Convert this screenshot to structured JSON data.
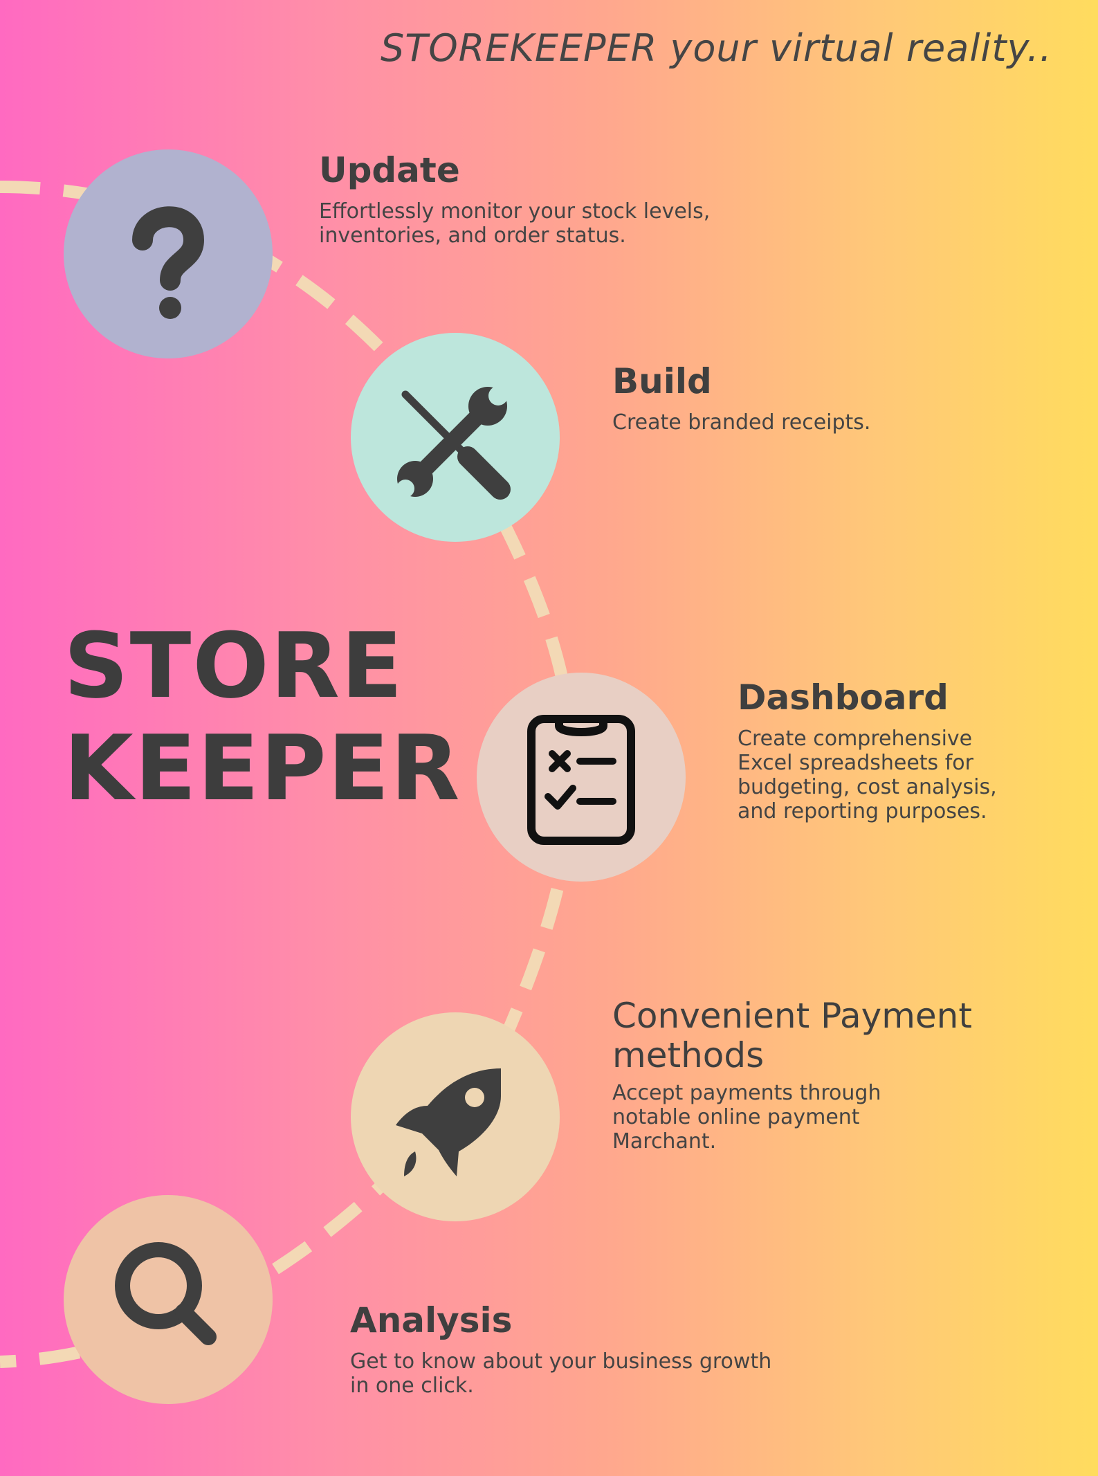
{
  "tagline": "STOREKEEPER your virtual reality..",
  "brand": {
    "line1": "STORE",
    "line2": "KEEPER"
  },
  "colors": {
    "gradient": [
      "#ff6ac1",
      "#ffa78e",
      "#ffdc5e"
    ],
    "dash": "#f3d9b5",
    "icon": "#3f3f3f"
  },
  "steps": [
    {
      "title": "Update",
      "desc": "Effortlessly monitor your stock levels,\ninventories, and order status.",
      "icon": "question-mark-icon",
      "circle_color": "#b1b2cf"
    },
    {
      "title": "Build",
      "desc": "Create branded receipts.",
      "icon": "wrench-screwdriver-icon",
      "circle_color": "#bde6dc"
    },
    {
      "title": "Dashboard",
      "desc": "Create comprehensive\nExcel spreadsheets for\nbudgeting, cost analysis,\nand reporting purposes.",
      "icon": "clipboard-checklist-icon",
      "circle_color": "#e8cfc4"
    },
    {
      "title": "Convenient Payment\nmethods",
      "desc": "Accept payments through\nnotable online payment\nMarchant.",
      "icon": "rocket-icon",
      "circle_color": "#eed6b3"
    },
    {
      "title": "Analysis",
      "desc": "Get to know about your business growth\nin one click.",
      "icon": "magnifier-icon",
      "circle_color": "#efc3a6"
    }
  ]
}
